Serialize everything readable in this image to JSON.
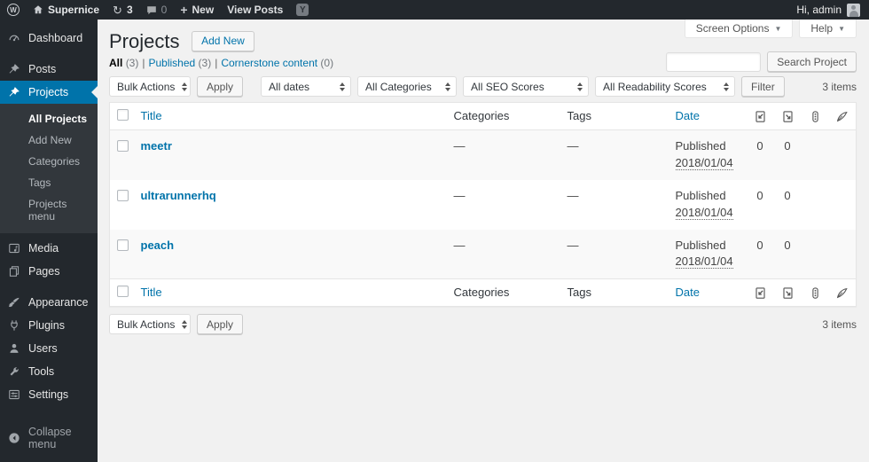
{
  "colors": {
    "accent": "#0073aa",
    "admin_bar_bg": "#23282d",
    "sidebar_bg": "#23282d",
    "submenu_bg": "#32373c",
    "content_bg": "#f1f1f1",
    "row_stripe": "#f9f9f9",
    "table_border": "#e5e5e5"
  },
  "icons": {
    "wp": "W",
    "yoast": "Y",
    "plus": "+",
    "update": "↻",
    "chevron_down": "▼"
  },
  "admin_bar": {
    "site_name": "Supernice",
    "update_count": "3",
    "comment_count": "0",
    "new_label": "New",
    "view_posts_label": "View Posts",
    "greeting": "Hi, admin"
  },
  "sidebar": {
    "items": [
      {
        "label": "Dashboard"
      },
      {
        "label": "Posts"
      },
      {
        "label": "Projects"
      },
      {
        "label": "Media"
      },
      {
        "label": "Pages"
      },
      {
        "label": "Appearance"
      },
      {
        "label": "Plugins"
      },
      {
        "label": "Users"
      },
      {
        "label": "Tools"
      },
      {
        "label": "Settings"
      }
    ],
    "submenu": [
      "All Projects",
      "Add New",
      "Categories",
      "Tags",
      "Projects menu"
    ],
    "collapse_label": "Collapse menu"
  },
  "meta_tabs": {
    "screen_options": "Screen Options",
    "help": "Help"
  },
  "page": {
    "title": "Projects",
    "add_new_label": "Add New",
    "filters": [
      {
        "label": "All",
        "count": "(3)"
      },
      {
        "label": "Published",
        "count": "(3)"
      },
      {
        "label": "Cornerstone content",
        "count": "(0)"
      }
    ],
    "filter_divider": "|",
    "search_placeholder": "",
    "search_button": "Search Project",
    "items_count": "3 items"
  },
  "bulk_bar": {
    "bulk_actions": "Bulk Actions",
    "apply": "Apply",
    "all_dates": "All dates",
    "all_categories": "All Categories",
    "all_seo": "All SEO Scores",
    "all_readability": "All Readability Scores",
    "filter": "Filter"
  },
  "table": {
    "headers": {
      "title": "Title",
      "categories": "Categories",
      "tags": "Tags",
      "date": "Date"
    },
    "icon_columns": [
      "incoming-links-icon",
      "outgoing-links-icon",
      "seo-score-icon",
      "readability-icon"
    ],
    "rows": [
      {
        "title": "meetr",
        "categories": "—",
        "tags": "—",
        "status": "Published",
        "date": "2018/01/04",
        "links_to": "0",
        "links_from": "0"
      },
      {
        "title": "ultrarunnerhq",
        "categories": "—",
        "tags": "—",
        "status": "Published",
        "date": "2018/01/04",
        "links_to": "0",
        "links_from": "0"
      },
      {
        "title": "peach",
        "categories": "—",
        "tags": "—",
        "status": "Published",
        "date": "2018/01/04",
        "links_to": "0",
        "links_from": "0"
      }
    ]
  }
}
